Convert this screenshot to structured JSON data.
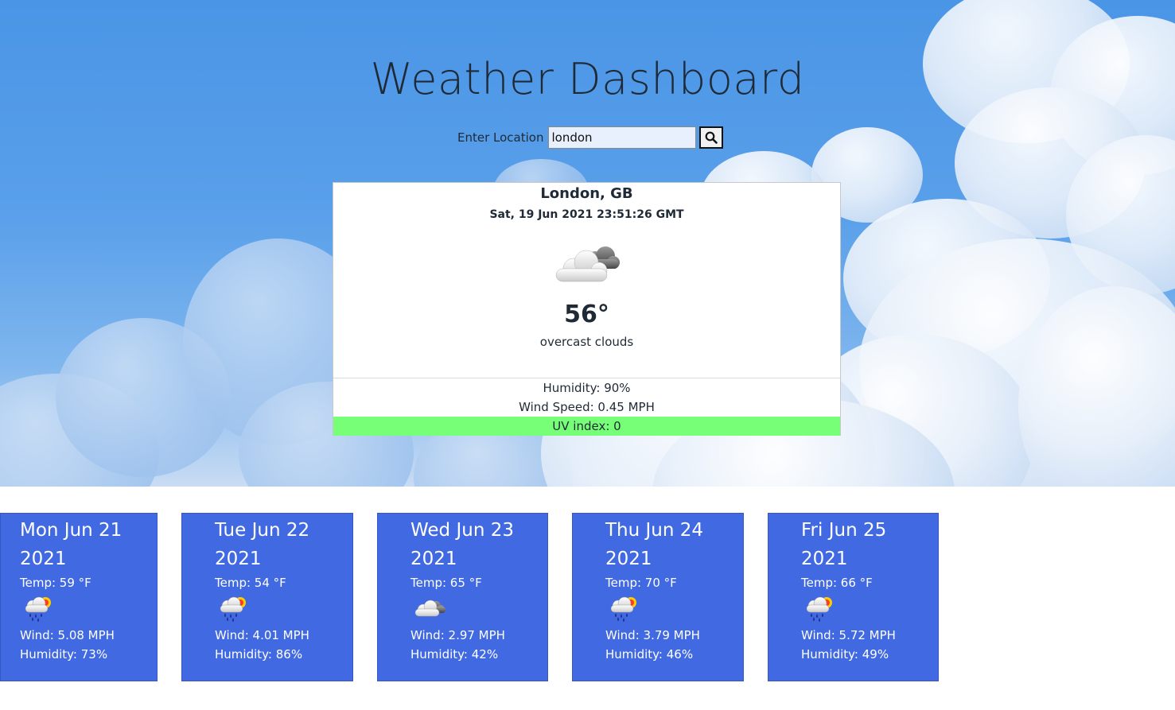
{
  "title": "Weather Dashboard",
  "search": {
    "label": "Enter Location",
    "value": "london",
    "button_icon": "search-icon"
  },
  "current": {
    "city": "London, GB",
    "datetime": "Sat, 19 Jun 2021 23:51:26 GMT",
    "icon": "overcast-clouds-icon",
    "temp": "56°",
    "description": "overcast clouds",
    "humidity": "Humidity: 90%",
    "wind": "Wind Speed: 0.45 MPH",
    "uv": "UV index: 0",
    "uv_color": "#77ff77"
  },
  "colors": {
    "forecast_bg": "#4169e1",
    "sky": "#4a95e6"
  },
  "forecast": [
    {
      "date": "Mon Jun 21 2021",
      "temp": "Temp: 59 °F",
      "icon": "rain-sun-icon",
      "wind": "Wind: 5.08 MPH",
      "humidity": "Humidity: 73%"
    },
    {
      "date": "Tue Jun 22 2021",
      "temp": "Temp: 54 °F",
      "icon": "rain-sun-icon",
      "wind": "Wind: 4.01 MPH",
      "humidity": "Humidity: 86%"
    },
    {
      "date": "Wed Jun 23 2021",
      "temp": "Temp: 65 °F",
      "icon": "cloudy-icon",
      "wind": "Wind: 2.97 MPH",
      "humidity": "Humidity: 42%"
    },
    {
      "date": "Thu Jun 24 2021",
      "temp": "Temp: 70 °F",
      "icon": "rain-sun-icon",
      "wind": "Wind: 3.79 MPH",
      "humidity": "Humidity: 46%"
    },
    {
      "date": "Fri Jun 25 2021",
      "temp": "Temp: 66 °F",
      "icon": "rain-sun-icon",
      "wind": "Wind: 5.72 MPH",
      "humidity": "Humidity: 49%"
    }
  ]
}
